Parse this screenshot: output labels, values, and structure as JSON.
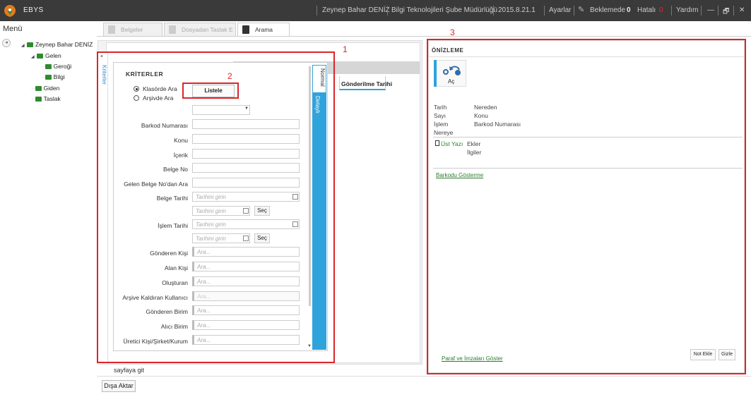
{
  "app": {
    "title": "EBYS"
  },
  "titlebar": {
    "user": "Zeynep Bahar DENİZ",
    "department": "Bilgi Teknolojileri Şube Müdürlüğü",
    "version": "2015.8.21.1",
    "settings": "Ayarlar",
    "pending_label": "Beklemede",
    "pending_count": "0",
    "error_label": "Hatalı",
    "error_count": "0",
    "help": "Yardım",
    "minimize": "—",
    "restore": "🗗",
    "close": "✕"
  },
  "sidebar": {
    "menu_label": "Menü",
    "collapse": "◂",
    "tree": {
      "root": "Zeynep Bahar DENİZ",
      "gelen": "Gelen",
      "gerogi": "Geroği",
      "bilgi": "Bilgi",
      "giden": "Giden",
      "taslak": "Taslak"
    }
  },
  "tabs": [
    {
      "label": "Belgeler",
      "active": false
    },
    {
      "label": "Dosyadan Taslak E",
      "active": false
    },
    {
      "label": "Arama",
      "active": true
    }
  ],
  "search": {
    "side_label": "Kriterler",
    "collapse": "◂",
    "title": "KRİTERLER",
    "radio_klasor": "Klasörde Ara",
    "radio_arsiv": "Arşivde Ara",
    "listele": "Listele",
    "fields": {
      "barkod": "Barkod Numarası",
      "konu": "Konu",
      "icerik": "İçerik",
      "belge_no": "Belge No",
      "gelen_belge_no": "Gelen Belge No'dan Ara",
      "belge_tarihi": "Belge Tarihi",
      "islem_tarihi": "İşlem Tarihi",
      "gonderen_kisi": "Gönderen Kişi",
      "alan_kisi": "Alan Kişi",
      "olusturan": "Oluşturan",
      "arsive_kaldiran": "Arşive Kaldıran Kullanıcı",
      "gonderen_birim": "Gönderen Birim",
      "alici_birim": "Alıcı Birim",
      "uretici": "Üretici Kişi/Şirket/Kurum"
    },
    "date_placeholder": "Tarihini girin",
    "ara_placeholder": "Ara...",
    "sec": "Seç",
    "tab_normal": "Normal",
    "tab_detayli": "Detaylı",
    "dropdown_arrow": "▼",
    "scroll_down": "▼"
  },
  "grid": {
    "column": "Gönderilme Tarihi"
  },
  "footer": {
    "paginate": "sayfaya git",
    "export": "Dışa Aktar"
  },
  "preview": {
    "title": "ÖNİZLEME",
    "ac": "Aç",
    "tarih": "Tarih",
    "nereden": "Nereden",
    "sayi": "Sayı",
    "konu": "Konu",
    "islem": "İşlem",
    "barkod": "Barkod Numarası",
    "nereye": "Nereye",
    "ust_yazi": "Üst Yazı",
    "ekler": "Ekler",
    "ilgiler": "İlgiler",
    "barkod_goster": "Barkodu Gösterme",
    "paraf": "Paraf ve İmzaları Göster",
    "not_ekle": "Not Ekle",
    "gizle": "Gizle"
  },
  "annotations": {
    "n1": "1",
    "n2": "2",
    "n3": "3"
  },
  "colors": {
    "accent": "#2ea3dc",
    "folder": "#2e8b2e",
    "annotation": "#d9262b",
    "titlebar": "#3a3a3a"
  }
}
